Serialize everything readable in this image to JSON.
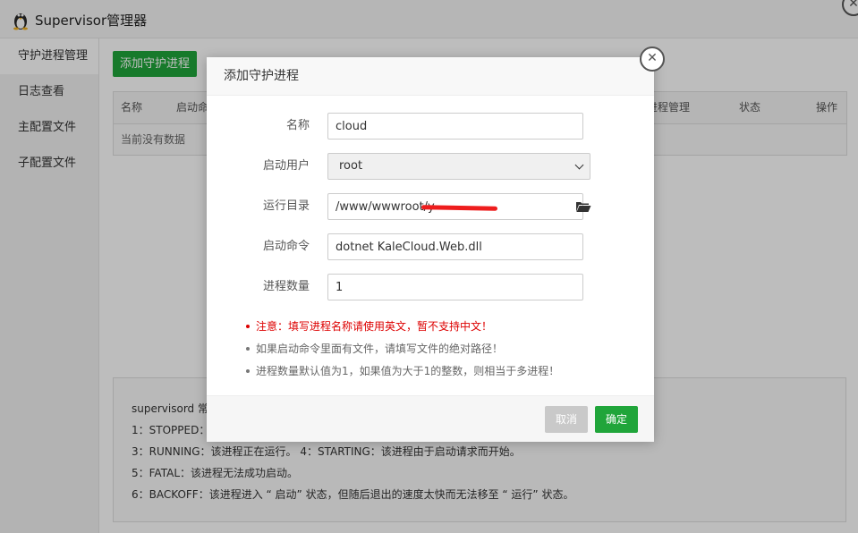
{
  "app": {
    "title": "Supervisor管理器"
  },
  "sidebar": {
    "items": [
      {
        "label": "守护进程管理"
      },
      {
        "label": "日志查看"
      },
      {
        "label": "主配置文件"
      },
      {
        "label": "子配置文件"
      }
    ]
  },
  "main": {
    "add_button": "添加守护进程",
    "table": {
      "columns": [
        "名称",
        "启动命",
        "进程管理",
        "状态",
        "操作"
      ],
      "empty_text": "当前没有数据"
    },
    "notes": [
      "supervisord 常",
      "1：STOPPED：",
      "3：RUNNING：该进程正在运行。 4：STARTING：该进程由于启动请求而开始。",
      "5：FATAL：该进程无法成功启动。",
      "6：BACKOFF：该进程进入 “ 启动” 状态，但随后退出的速度太快而无法移至 “ 运行” 状态。"
    ]
  },
  "modal": {
    "title": "添加守护进程",
    "close_glyph": "✕",
    "fields": {
      "name": {
        "label": "名称",
        "value": "cloud"
      },
      "user": {
        "label": "启动用户",
        "value": "root"
      },
      "dir": {
        "label": "运行目录",
        "value": "/www/wwwroot/y"
      },
      "command": {
        "label": "启动命令",
        "value": "dotnet KaleCloud.Web.dll"
      },
      "count": {
        "label": "进程数量",
        "value": "1"
      }
    },
    "tips": [
      "注意：填写进程名称请使用英文，暂不支持中文！",
      "如果启动命令里面有文件，请填写文件的绝对路径！",
      "进程数量默认值为1，如果值为大于1的整数，则相当于多进程！"
    ],
    "cancel_label": "取消",
    "ok_label": "确定"
  },
  "colors": {
    "accent": "#20a53a",
    "warning": "#dd0000",
    "cancel": "#c9c9c9"
  },
  "icons": {
    "logo": "linux-penguin-icon",
    "close": "close-icon",
    "folder": "folder-open-icon",
    "dropdown": "chevron-down-icon"
  }
}
